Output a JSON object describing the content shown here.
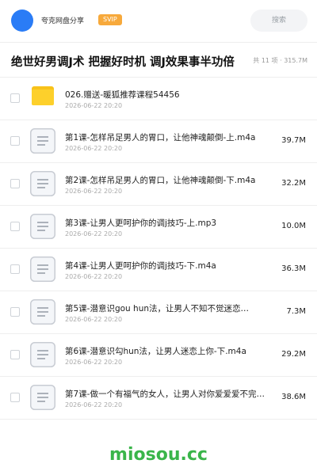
{
  "header": {
    "username": "夸克网盘分享",
    "badge": "SVIP",
    "search_placeholder": "搜索",
    "colors": {
      "avatar": "#2a7cf6",
      "badge": "#f7a93b"
    }
  },
  "share": {
    "title": "绝世好男调J术 把握好时机 调J效果事半功倍",
    "meta": "共 11 项 · 315.7M"
  },
  "files": [
    {
      "type": "folder",
      "icon": "folder-icon",
      "name": "026.赠送-暖狐推荐课程54456",
      "date": "2026-06-22 20:20",
      "size": ""
    },
    {
      "type": "file",
      "icon": "document-icon",
      "name": "第1课-怎样吊足男人的胃口，让他神魂颠倒-上.m4a",
      "date": "2026-06-22 20:20",
      "size": "39.7M"
    },
    {
      "type": "file",
      "icon": "document-icon",
      "name": "第2课-怎样吊足男人的胃口，让他神魂颠倒-下.m4a",
      "date": "2026-06-22 20:20",
      "size": "32.2M"
    },
    {
      "type": "file",
      "icon": "document-icon",
      "name": "第3课-让男人更呵护你的调j技巧-上.mp3",
      "date": "2026-06-22 20:20",
      "size": "10.0M"
    },
    {
      "type": "file",
      "icon": "document-icon",
      "name": "第4课-让男人更呵护你的调j技巧-下.m4a",
      "date": "2026-06-22 20:20",
      "size": "36.3M"
    },
    {
      "type": "file",
      "icon": "document-icon",
      "name": "第5课-潜意识gou hun法，让男人不知不觉迷恋…",
      "date": "2026-06-22 20:20",
      "size": "7.3M"
    },
    {
      "type": "file",
      "icon": "document-icon",
      "name": "第6课-潜意识勾hun法，让男人迷恋上你-下.m4a",
      "date": "2026-06-22 20:20",
      "size": "29.2M"
    },
    {
      "type": "file",
      "icon": "document-icon",
      "name": "第7课-做一个有福气的女人，让男人对你爱爱爱不完…",
      "date": "2026-06-22 20:20",
      "size": "38.6M"
    }
  ],
  "watermark": "miosou.cc"
}
